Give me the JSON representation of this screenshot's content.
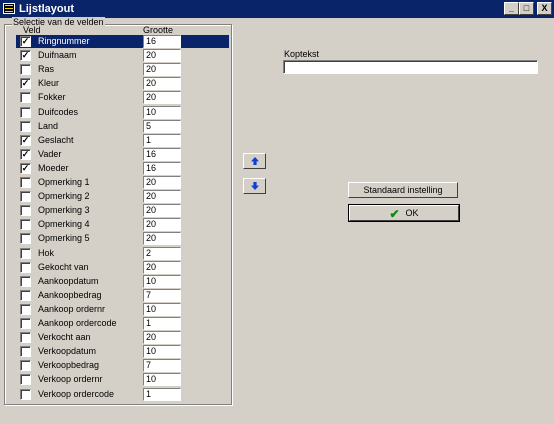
{
  "window": {
    "title": "Lijstlayout",
    "min_label": "_",
    "max_label": "□",
    "close_label": "X"
  },
  "group": {
    "title": "Selectie van de velden",
    "col_field": "Veld",
    "col_size": "Grootte"
  },
  "fields": [
    {
      "label": "Ringnummer",
      "checked": true,
      "size": "16",
      "selected": true
    },
    {
      "label": "Duifnaam",
      "checked": true,
      "size": "20"
    },
    {
      "label": "Ras",
      "checked": false,
      "size": "20"
    },
    {
      "label": "Kleur",
      "checked": true,
      "size": "20"
    },
    {
      "label": "Fokker",
      "checked": false,
      "size": "20"
    },
    {
      "label": "Duifcodes",
      "checked": false,
      "size": "10"
    },
    {
      "label": "Land",
      "checked": false,
      "size": "5"
    },
    {
      "label": "Geslacht",
      "checked": true,
      "size": "1"
    },
    {
      "label": "Vader",
      "checked": true,
      "size": "16"
    },
    {
      "label": "Moeder",
      "checked": true,
      "size": "16"
    },
    {
      "label": "Opmerking 1",
      "checked": false,
      "size": "20"
    },
    {
      "label": "Opmerking 2",
      "checked": false,
      "size": "20"
    },
    {
      "label": "Opmerking 3",
      "checked": false,
      "size": "20"
    },
    {
      "label": "Opmerking 4",
      "checked": false,
      "size": "20"
    },
    {
      "label": "Opmerking 5",
      "checked": false,
      "size": "20"
    },
    {
      "label": "Hok",
      "checked": false,
      "size": "2"
    },
    {
      "label": "Gekocht van",
      "checked": false,
      "size": "20"
    },
    {
      "label": "Aankoopdatum",
      "checked": false,
      "size": "10"
    },
    {
      "label": "Aankoopbedrag",
      "checked": false,
      "size": "7"
    },
    {
      "label": "Aankoop ordernr",
      "checked": false,
      "size": "10"
    },
    {
      "label": "Aankoop ordercode",
      "checked": false,
      "size": "1"
    },
    {
      "label": "Verkocht aan",
      "checked": false,
      "size": "20"
    },
    {
      "label": "Verkoopdatum",
      "checked": false,
      "size": "10"
    },
    {
      "label": "Verkoopbedrag",
      "checked": false,
      "size": "7"
    },
    {
      "label": "Verkoop ordernr",
      "checked": false,
      "size": "10"
    },
    {
      "label": "Verkoop ordercode",
      "checked": false,
      "size": "1"
    }
  ],
  "header_field": {
    "label": "Koptekst",
    "value": ""
  },
  "buttons": {
    "default_label": "Standaard instelling",
    "ok_label": "OK"
  },
  "colors": {
    "title_bar": "#0a246a",
    "face": "#d4d0c8",
    "selection": "#0a246a",
    "arrow": "#1040d0",
    "ok_check": "#0a8a0a"
  },
  "icons": {
    "move_up": "arrow-up-icon",
    "move_down": "arrow-down-icon",
    "ok": "check-icon"
  }
}
